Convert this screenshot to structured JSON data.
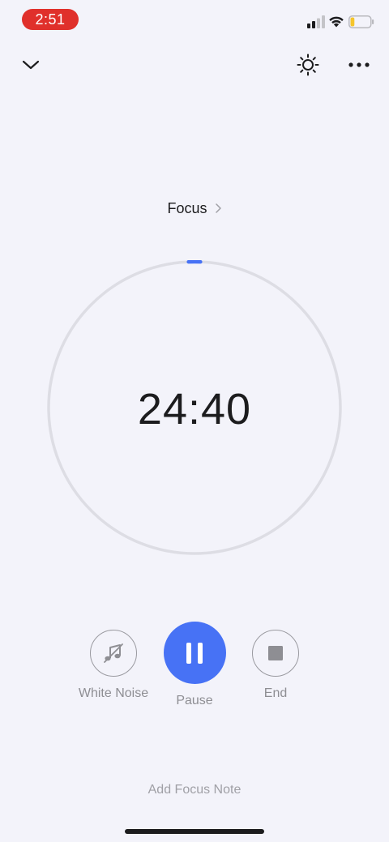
{
  "status_bar": {
    "time": "2:51",
    "signal_icon": "cellular-signal-icon",
    "wifi_icon": "wifi-icon",
    "battery_icon": "battery-low-icon",
    "battery_level": 0.2,
    "accent_time_pill": "#e0302b"
  },
  "toolbar": {
    "collapse_icon": "chevron-down-icon",
    "brightness_icon": "sun-icon",
    "more_icon": "more-horizontal-icon"
  },
  "mode": {
    "label": "Focus",
    "chevron_icon": "chevron-right-icon"
  },
  "timer": {
    "remaining": "24:40",
    "progress_fraction": 0.013,
    "accent": "#4772f5"
  },
  "controls": {
    "white_noise": {
      "label": "White Noise",
      "icon": "music-note-slash-icon"
    },
    "pause": {
      "label": "Pause",
      "icon": "pause-icon"
    },
    "end": {
      "label": "End",
      "icon": "stop-icon"
    }
  },
  "footer": {
    "note_label": "Add Focus Note"
  }
}
